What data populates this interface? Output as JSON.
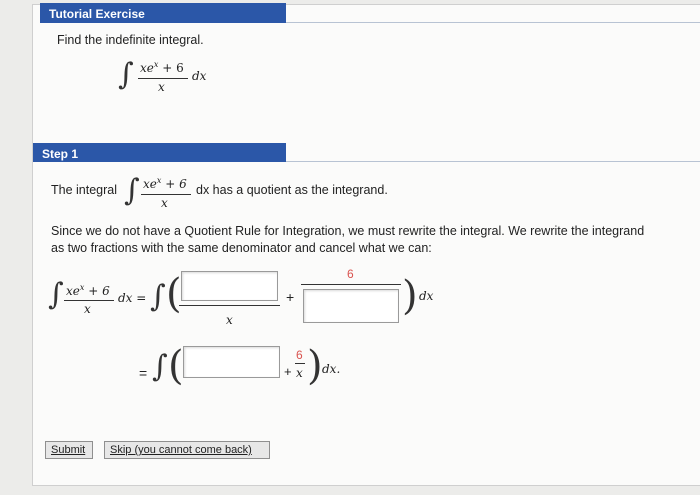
{
  "section1": {
    "header": "Tutorial Exercise",
    "prompt": "Find the indefinite integral.",
    "integrand_numerator_base": "xe",
    "integrand_numerator_exp": "x",
    "integrand_numerator_plus": "+ 6",
    "integrand_denominator": "x",
    "differential": "dx"
  },
  "step1": {
    "header": "Step 1",
    "intro_label": "The integral",
    "intro_suffix": "dx has a quotient as the integrand.",
    "explain_line1": "Since we do not have a Quotient Rule for Integration, we must rewrite the integral. We rewrite the integrand",
    "explain_line2": "as two fractions with the same denominator and cancel what we can:",
    "equation1": {
      "lhs_dx": "dx =",
      "denominator": "x",
      "plus": "+",
      "prefilled_numerator": "6",
      "trailing_dx": "dx"
    },
    "equation2": {
      "equals": "=",
      "plus": "+",
      "frac_num": "6",
      "frac_den": "x",
      "trailing_dx": "dx."
    }
  },
  "buttons": {
    "submit": "Submit",
    "skip": "Skip (you cannot come back)"
  },
  "colors": {
    "header_bg": "#2b57a8",
    "prefilled_value": "#d9534f"
  }
}
